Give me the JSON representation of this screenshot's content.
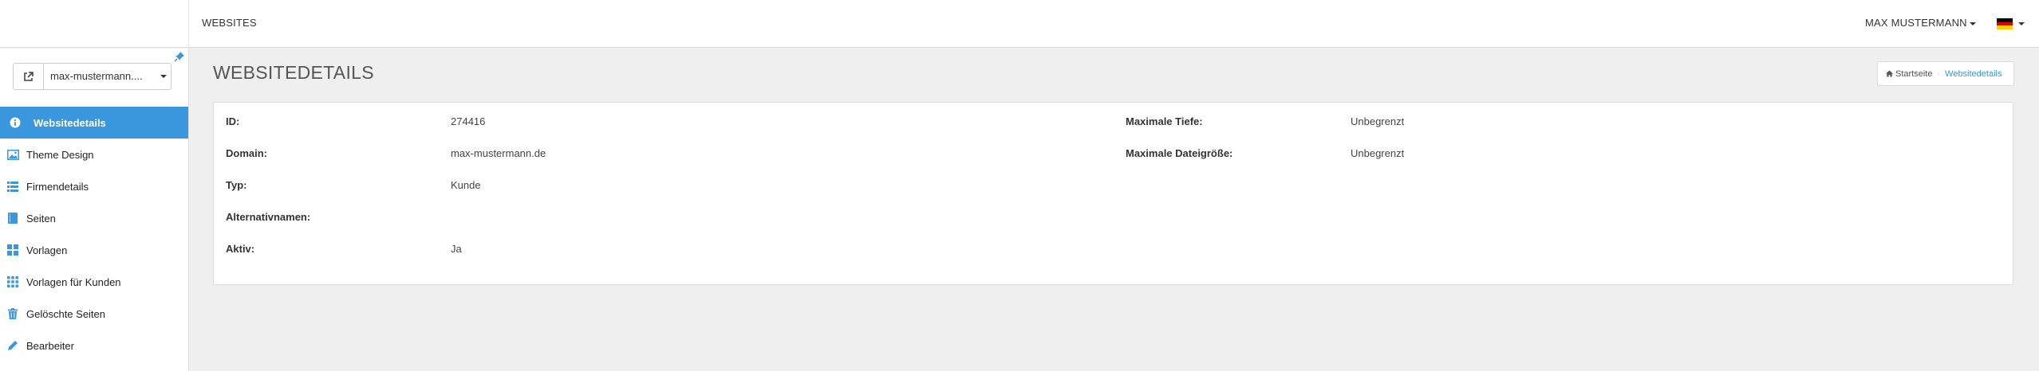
{
  "topbar": {
    "nav_websites": "WEBSITES",
    "user_name": "MAX MUSTERMANN",
    "language_flag": "german-flag-icon"
  },
  "sidebar": {
    "site_select_value": "max-mustermann....",
    "items": [
      {
        "label": "Websitedetails",
        "icon": "info-icon",
        "active": true
      },
      {
        "label": "Theme Design",
        "icon": "image-icon",
        "active": false
      },
      {
        "label": "Firmendetails",
        "icon": "list-icon",
        "active": false
      },
      {
        "label": "Seiten",
        "icon": "book-icon",
        "active": false
      },
      {
        "label": "Vorlagen",
        "icon": "grid-icon",
        "active": false
      },
      {
        "label": "Vorlagen für Kunden",
        "icon": "apps-icon",
        "active": false
      },
      {
        "label": "Gelöschte Seiten",
        "icon": "trash-icon",
        "active": false
      },
      {
        "label": "Bearbeiter",
        "icon": "pencil-icon",
        "active": false
      }
    ]
  },
  "header": {
    "title": "WEBSITEDETAILS",
    "breadcrumb": {
      "home": "Startseite",
      "current": "Websitedetails"
    }
  },
  "details": {
    "left": [
      {
        "label": "ID:",
        "value": "274416"
      },
      {
        "label": "Domain:",
        "value": "max-mustermann.de"
      },
      {
        "label": "Typ:",
        "value": "Kunde"
      },
      {
        "label": "Alternativnamen:",
        "value": ""
      },
      {
        "label": "Aktiv:",
        "value": "Ja"
      }
    ],
    "right": [
      {
        "label": "Maximale Tiefe:",
        "value": "Unbegrenzt"
      },
      {
        "label": "Maximale Dateigröße:",
        "value": "Unbegrenzt"
      }
    ]
  },
  "colors": {
    "accent": "#3a97dd",
    "background": "#efefef"
  }
}
